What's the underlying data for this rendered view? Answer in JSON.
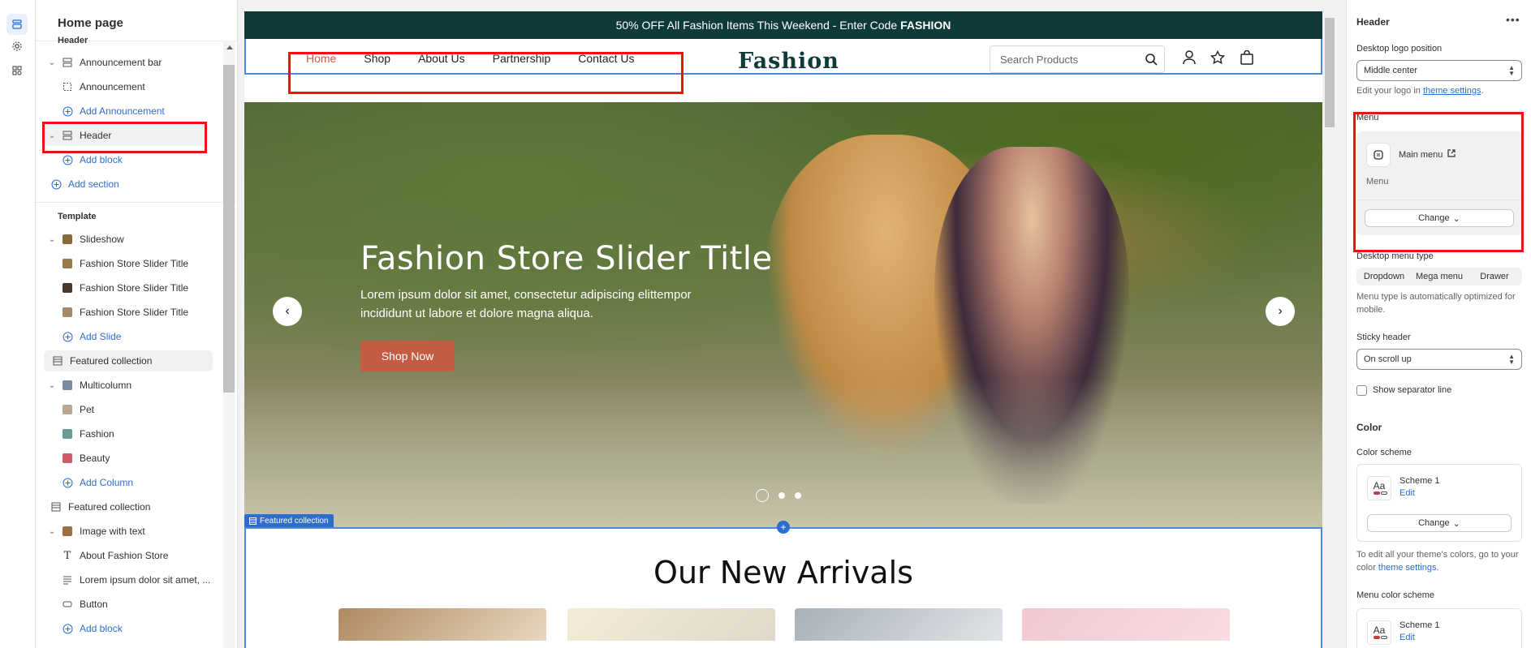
{
  "sidebar": {
    "title": "Home page",
    "header_group": "Header",
    "announcement_bar": "Announcement bar",
    "announcement": "Announcement",
    "add_announcement": "Add Announcement",
    "header": "Header",
    "add_block_1": "Add block",
    "add_section": "Add section",
    "template_group": "Template",
    "slideshow": "Slideshow",
    "slide_1": "Fashion Store Slider Title",
    "slide_2": "Fashion Store Slider Title",
    "slide_3": "Fashion Store Slider Title",
    "add_slide": "Add Slide",
    "featured_collection_1": "Featured collection",
    "multicolumn": "Multicolumn",
    "col_pet": "Pet",
    "col_fashion": "Fashion",
    "col_beauty": "Beauty",
    "add_column": "Add Column",
    "featured_collection_2": "Featured collection",
    "image_with_text": "Image with text",
    "about_store": "About Fashion Store",
    "lorem": "Lorem ipsum dolor sit amet, ...",
    "button": "Button",
    "add_block_2": "Add block"
  },
  "preview": {
    "announcement_text": "50% OFF All Fashion Items This Weekend - Enter Code",
    "announcement_code": "FASHION",
    "nav": [
      "Home",
      "Shop",
      "About Us",
      "Partnership",
      "Contact Us"
    ],
    "logo": "Fashion",
    "search_placeholder": "Search Products",
    "hero_title": "Fashion Store Slider Title",
    "hero_text": "Lorem ipsum dolor sit amet, consectetur adipiscing elittempor incididunt ut labore et dolore magna aliqua.",
    "hero_button": "Shop Now",
    "featured_tag": "Featured collection",
    "arrivals_title": "Our New Arrivals"
  },
  "panel": {
    "title": "Header",
    "logo_position_label": "Desktop logo position",
    "logo_position_value": "Middle center",
    "logo_help_prefix": "Edit your logo in",
    "logo_help_link": "theme settings",
    "menu_label": "Menu",
    "menu_name": "Main menu",
    "menu_sub": "Menu",
    "change_label": "Change",
    "menu_type_label": "Desktop menu type",
    "menu_types": [
      "Dropdown",
      "Mega menu",
      "Drawer"
    ],
    "menu_type_help": "Menu type is automatically optimized for mobile.",
    "sticky_label": "Sticky header",
    "sticky_value": "On scroll up",
    "separator_label": "Show separator line",
    "color_heading": "Color",
    "color_scheme_label": "Color scheme",
    "scheme_name": "Scheme 1",
    "scheme_edit": "Edit",
    "scheme_change": "Change",
    "color_help_prefix": "To edit all your theme's colors, go to your color",
    "color_help_link": "theme settings",
    "menu_color_label": "Menu color scheme",
    "menu_scheme_name": "Scheme 1",
    "menu_scheme_edit": "Edit",
    "swatch_text": "Aa"
  },
  "colors": {
    "accent": "#2c6ecb",
    "announcement_bg": "#0e3b3a",
    "brand_button": "#c45b43",
    "annotation_red": "#ee1111"
  }
}
